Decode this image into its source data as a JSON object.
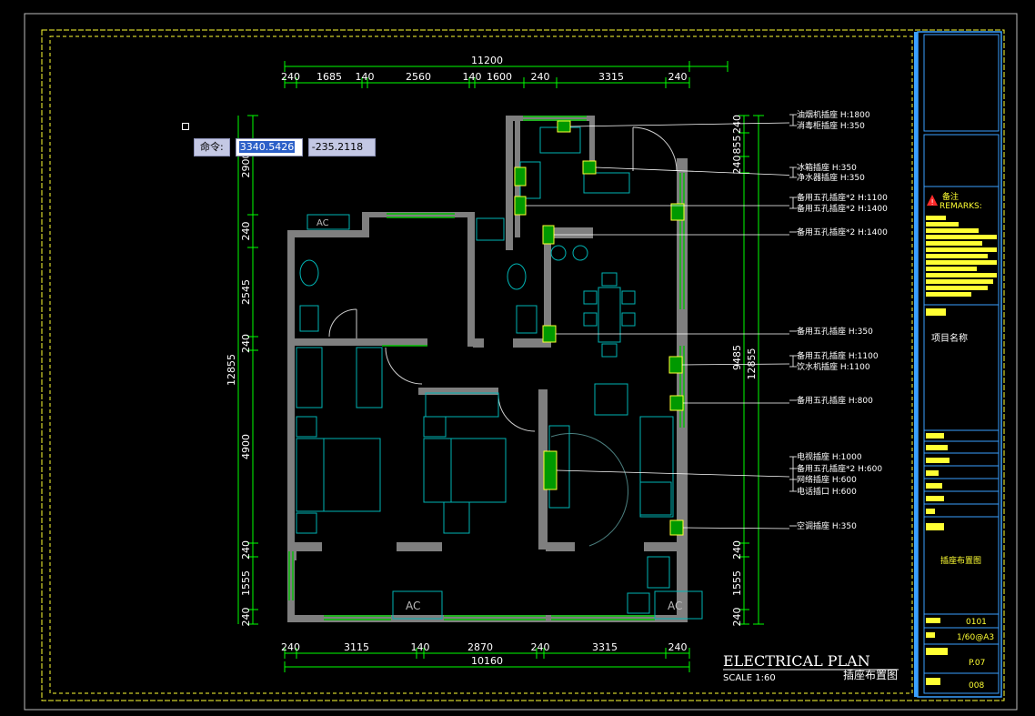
{
  "command_line": {
    "label": "命令:",
    "x_value": "3340.5426",
    "y_value": "-235.2118"
  },
  "dimensions": {
    "top_total": "11200",
    "top_segments": [
      "240",
      "1685",
      "140",
      "2560",
      "140",
      "1600",
      "240",
      "3315",
      "240"
    ],
    "bottom_total": "10160",
    "bottom_segments": [
      "240",
      "3115",
      "140",
      "2870",
      "240",
      "3315",
      "240"
    ],
    "left_total": "12855",
    "left_segments": [
      "2900",
      "240",
      "2545",
      "240",
      "4900",
      "240",
      "1555",
      "240"
    ],
    "right_total": "12855",
    "right_inner": "9485",
    "right_segments": [
      "240",
      "855",
      "240",
      "240",
      "1555",
      "240"
    ]
  },
  "callouts": [
    {
      "lines": [
        "油烟机插座 H:1800",
        "消毒柜插座 H:350"
      ]
    },
    {
      "lines": [
        "冰箱插座 H:350",
        "净水器插座 H:350"
      ]
    },
    {
      "lines": [
        "备用五孔插座*2 H:1100",
        "备用五孔插座*2 H:1400"
      ]
    },
    {
      "lines": [
        "备用五孔插座*2 H:1400"
      ]
    },
    {
      "lines": [
        "备用五孔插座 H:350"
      ]
    },
    {
      "lines": [
        "备用五孔插座 H:1100",
        "饮水机插座 H:1100"
      ]
    },
    {
      "lines": [
        "备用五孔插座 H:800"
      ]
    },
    {
      "lines": [
        "电视插座 H:1000",
        "备用五孔插座*2 H:600",
        "网络插座 H:600",
        "电话插口 H:600"
      ]
    },
    {
      "lines": [
        "空调插座 H:350"
      ]
    }
  ],
  "plan_title": {
    "title": "ELECTRICAL PLAN",
    "scale": "SCALE 1:60",
    "cn_title": "插座布置图"
  },
  "ac_label": "AC",
  "title_block": {
    "remarks_cn": "备注",
    "remarks_en": "REMARKS:",
    "project_name": "项目名称",
    "drawing_name": "插座布置图",
    "drawing_no": "0101",
    "scale": "1/60@A3",
    "page": "P.07",
    "sheet": "008"
  },
  "colors": {
    "background": "#000000",
    "wall": "#7f7f7f",
    "window": "#00c000",
    "dim": "#00ff00",
    "frame": "#ffff33",
    "furniture": "#00b4b4",
    "title_block": "#3aa0ff"
  }
}
